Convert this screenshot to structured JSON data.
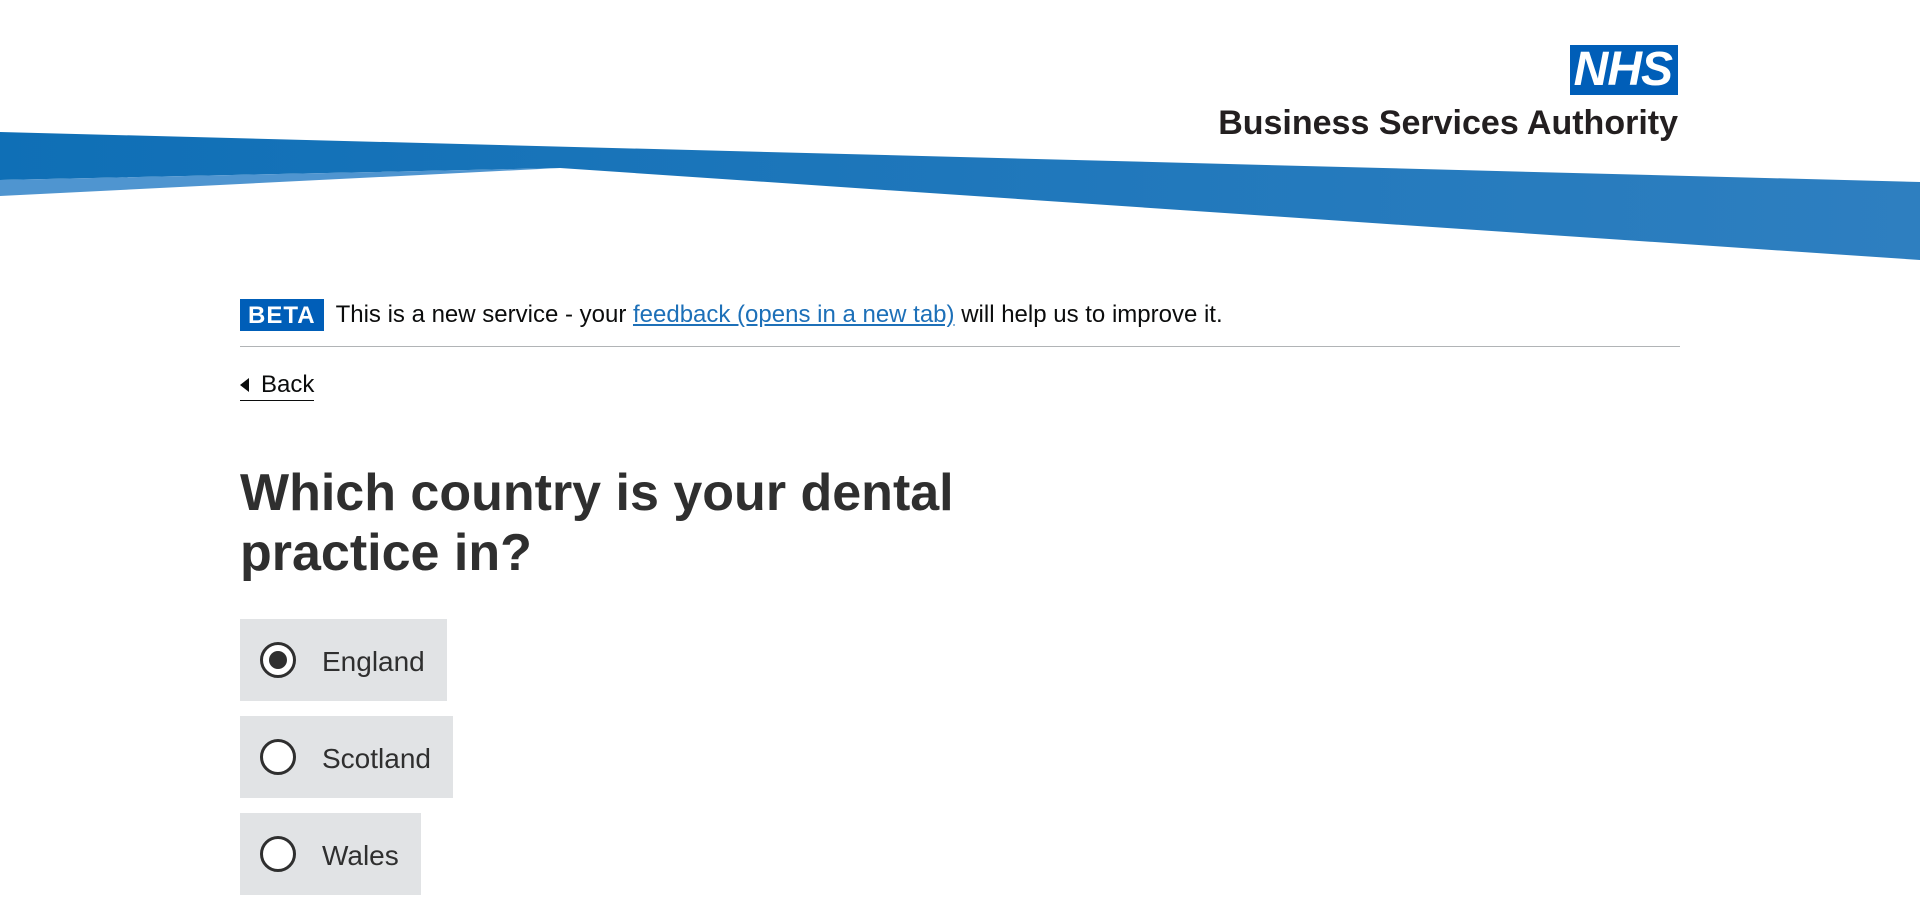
{
  "header": {
    "logo_text": "NHS",
    "org_name": "Business Services Authority",
    "colors": {
      "brand_blue": "#005eb8",
      "swoosh_dark": "#0f6fb6",
      "swoosh_light": "#4f95d0"
    }
  },
  "phase_banner": {
    "tag": "BETA",
    "text_before": "This is a new service - your ",
    "link_text": "feedback (opens in a new tab)",
    "text_after": " will help us to improve it."
  },
  "back_link": {
    "label": "Back",
    "icon": "chevron-left-icon"
  },
  "page": {
    "title": "Which country is your dental practice in?"
  },
  "radios": {
    "selected": "England",
    "options": [
      {
        "label": "England",
        "checked": true
      },
      {
        "label": "Scotland",
        "checked": false
      },
      {
        "label": "Wales",
        "checked": false
      }
    ]
  }
}
